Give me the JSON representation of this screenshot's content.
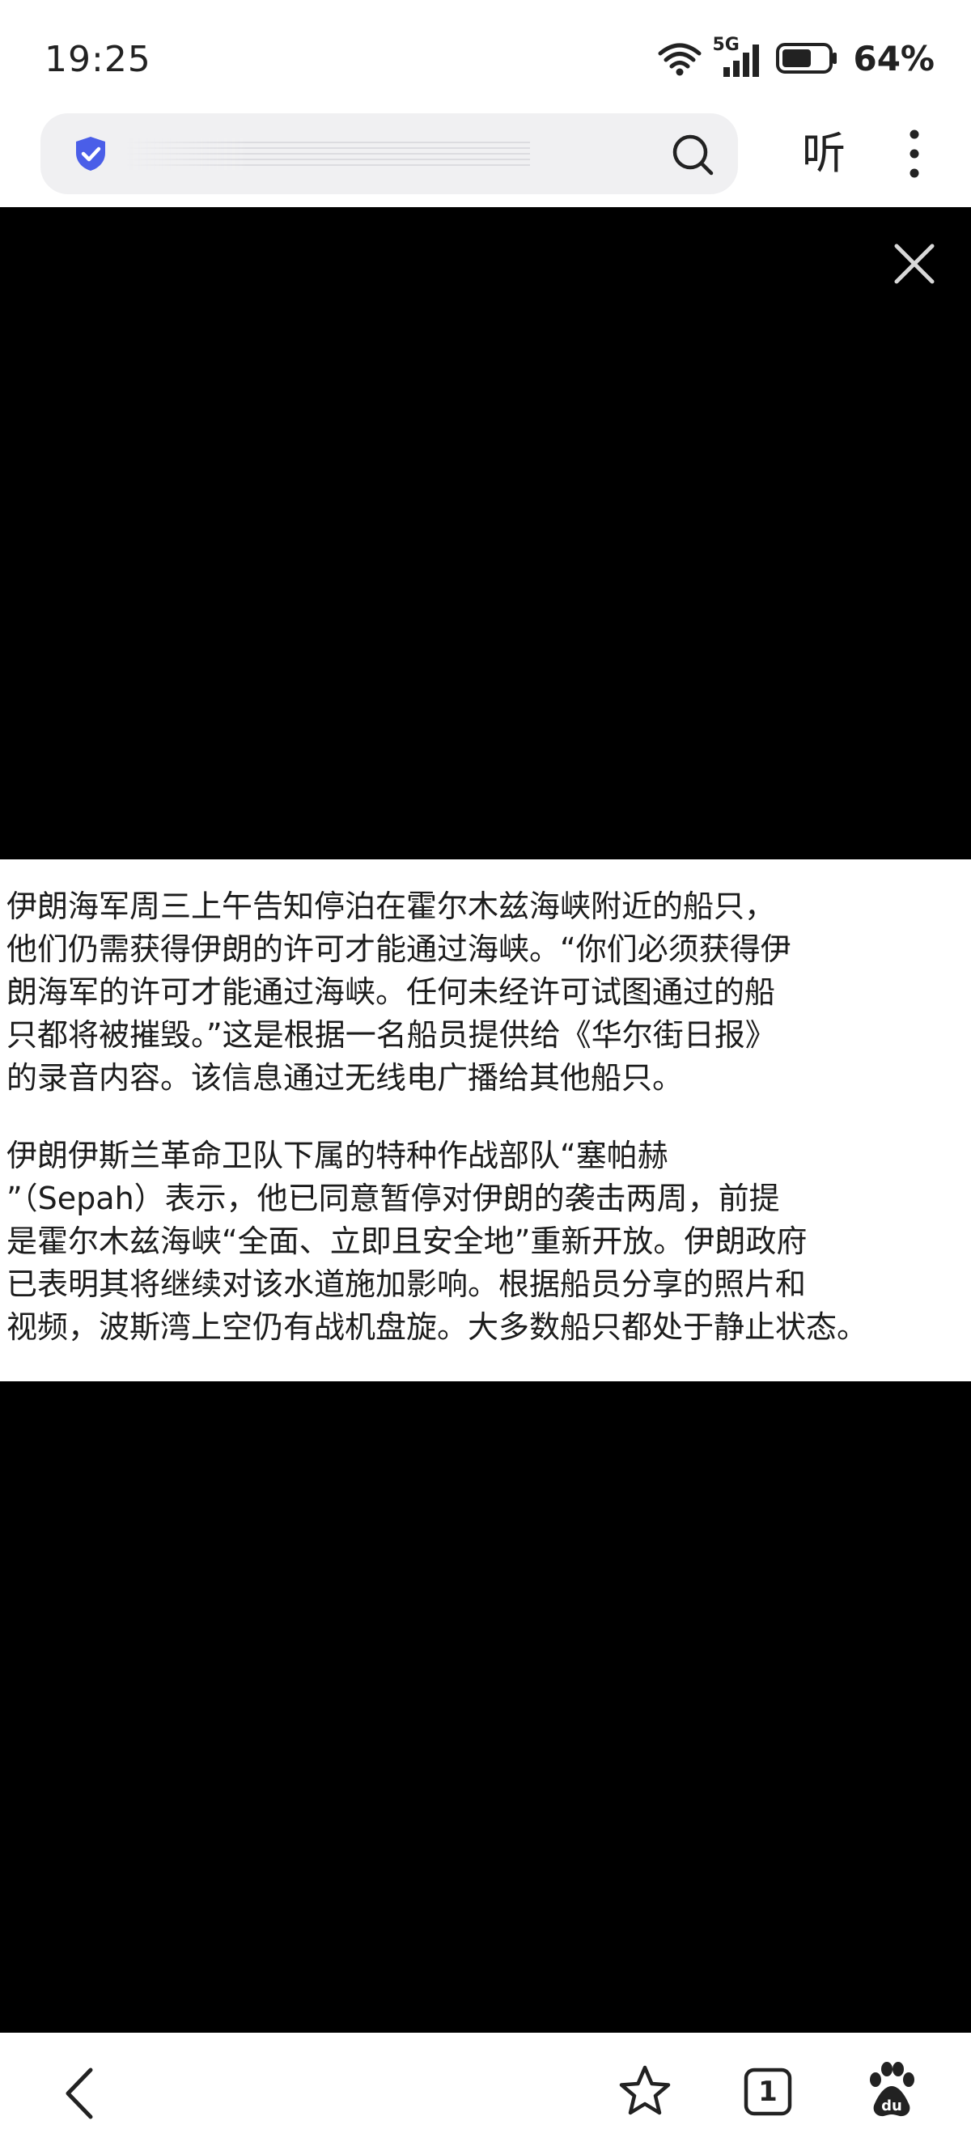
{
  "status_bar": {
    "time": "19:25",
    "network": "5G",
    "battery_percent": "64%",
    "battery_level": 0.64
  },
  "browser": {
    "listen_label": "听",
    "tab_count": "1"
  },
  "article": {
    "paragraphs": [
      {
        "lines": [
          "伊朗海军周三上午告知停泊在霍尔木兹海峡附近的船只，",
          "他们仍需获得伊朗的许可才能通过海峡。“你们必须获得伊",
          "朗海军的许可才能通过海峡。任何未经许可试图通过的船",
          "只都将被摧毁。”这是根据一名船员提供给《华尔街日报》",
          "的录音内容。该信息通过无线电广播给其他船只。"
        ]
      },
      {
        "lines": [
          "伊朗伊斯兰革命卫队下属的特种作战部队“塞帕赫",
          "”（Sepah）表示，他已同意暂停对伊朗的袭击两周，前提",
          "是霍尔木兹海峡“全面、立即且安全地”重新开放。伊朗政府",
          "已表明其将继续对该水道施加影响。根据船员分享的照片和",
          "视频，波斯湾上空仍有战机盘旋。大多数船只都处于静止状态。"
        ]
      }
    ]
  },
  "icons": {
    "shield": "shield-check-icon",
    "search": "search-icon",
    "more": "more-vertical-icon",
    "close": "close-icon",
    "back": "back-arrow-icon",
    "bookmark": "star-icon",
    "tabs": "tabs-icon",
    "baidu": "baidu-paw-icon"
  },
  "colors": {
    "shield_accent": "#4a5ee8",
    "media_background": "#000000",
    "address_bar_background": "#f0f0f2"
  }
}
